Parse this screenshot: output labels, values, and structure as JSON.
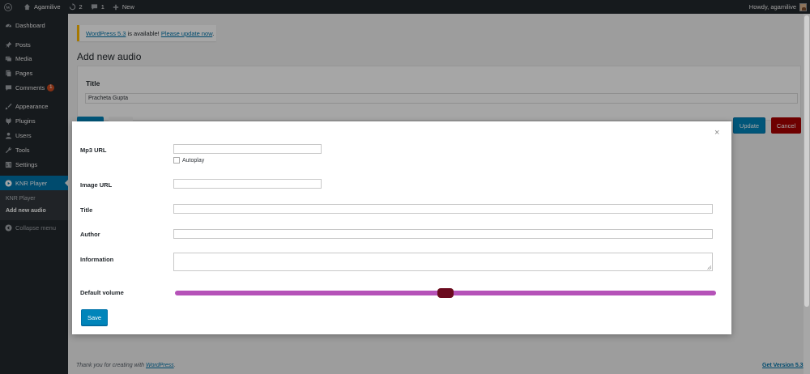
{
  "adminbar": {
    "site_name": "Agamilive",
    "updates_count": "2",
    "comments_count": "1",
    "new_label": "New",
    "howdy": "Howdy, agamilive"
  },
  "sidebar": {
    "items": [
      {
        "label": "Dashboard",
        "icon": "dashboard-icon"
      },
      {
        "label": "Posts",
        "icon": "pin-icon"
      },
      {
        "label": "Media",
        "icon": "media-icon"
      },
      {
        "label": "Pages",
        "icon": "pages-icon"
      },
      {
        "label": "Comments",
        "icon": "comment-icon",
        "badge": "1"
      },
      {
        "label": "Appearance",
        "icon": "brush-icon"
      },
      {
        "label": "Plugins",
        "icon": "plugin-icon"
      },
      {
        "label": "Users",
        "icon": "users-icon"
      },
      {
        "label": "Tools",
        "icon": "wrench-icon"
      },
      {
        "label": "Settings",
        "icon": "settings-icon"
      },
      {
        "label": "KNR Player",
        "icon": "player-icon"
      }
    ],
    "submenu": [
      "KNR Player",
      "Add new audio"
    ],
    "collapse_label": "Collapse menu"
  },
  "notice": {
    "link1": "WordPress 5.3",
    "text": " is available! ",
    "link2": "Please update now",
    "end": "."
  },
  "page": {
    "title": "Add new audio",
    "postbox_title": "Title",
    "title_value": "Pracheta Gupta",
    "update_label": "Update",
    "cancel_label": "Cancel"
  },
  "footer": {
    "thanks_prefix": "Thank you for creating with ",
    "thanks_link": "WordPress",
    "thanks_suffix": ".",
    "version_link": "Get Version 5.3"
  },
  "modal": {
    "close_symbol": "×",
    "mp3_label": "Mp3 URL",
    "mp3_value": "",
    "autoplay_label": "Autoplay",
    "autoplay_checked": false,
    "image_label": "Image URL",
    "image_value": "",
    "title_label": "Title",
    "title_value": "",
    "author_label": "Author",
    "author_value": "",
    "info_label": "Information",
    "info_value": "",
    "volume_label": "Default volume",
    "volume_fraction": 0.5,
    "save_label": "Save"
  },
  "colors": {
    "accent": "#0085ba",
    "admin_dark": "#23282d",
    "active_menu": "#0073aa",
    "cancel": "#aa0000",
    "slider_track": "#b552b8",
    "slider_handle": "#6b0a1e",
    "notice_border": "#ffb900",
    "badge": "#ca4a1f"
  }
}
